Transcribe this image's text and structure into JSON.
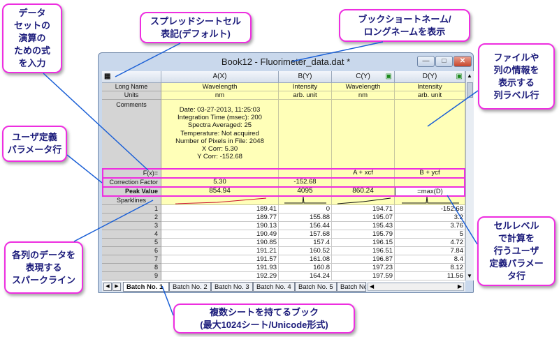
{
  "callouts": {
    "formula": "データ\nセットの\n演算の\nための式\nを入力",
    "spreadsheet_notation": "スプレッドシートセル\n表記(デフォルト)",
    "book_name": "ブックショートネーム/\nロングネームを表示",
    "label_rows": "ファイルや\n列の情報を\n表示する\n列ラベル行",
    "user_params": "ユーザ定義\nパラメータ行",
    "sparklines": "各列のデータを\n表現する\nスパークライン",
    "cell_calc": "セルレベル\nで計算を\n行うユーザ\n定義パラメー\nタ行",
    "sheets": "複数シートを持てるブック\n(最大1024シート/Unicode形式)"
  },
  "window": {
    "title": "Book12 - Fluorimeter_data.dat *"
  },
  "columns": [
    {
      "header": "A(X)",
      "long_name": "Wavelength",
      "units": "nm",
      "fx": "",
      "correction": "5.30",
      "peak": "854.94"
    },
    {
      "header": "B(Y)",
      "long_name": "Intensity",
      "units": "arb. unit",
      "fx": "",
      "correction": "-152.68",
      "peak": "4095"
    },
    {
      "header": "C(Y)",
      "long_name": "Wavelength",
      "units": "nm",
      "fx": "A + xcf",
      "correction": "",
      "peak": "860.24"
    },
    {
      "header": "D(Y)",
      "long_name": "Intensity",
      "units": "arb. unit",
      "fx": "B + ycf",
      "correction": "",
      "peak": "=max(D)"
    }
  ],
  "row_labels": {
    "long_name": "Long Name",
    "units": "Units",
    "comments": "Comments",
    "fx": "F(x)=",
    "correction": "Correction Factor",
    "peak": "Peak Value",
    "sparklines": "Sparklines"
  },
  "comments_lines": [
    "Date: 03-27-2013, 11:25:03",
    "Integration Time (msec): 200",
    "Spectra Averaged: 25",
    "Temperature: Not acquired",
    "Number of Pixels in File: 2048",
    "X Corr: 5.30",
    "Y Corr: -152.68"
  ],
  "data_rows": [
    {
      "n": "1",
      "a": "189.41",
      "b": "0",
      "c": "194.71",
      "d": "-152.68"
    },
    {
      "n": "2",
      "a": "189.77",
      "b": "155.88",
      "c": "195.07",
      "d": "3.2"
    },
    {
      "n": "3",
      "a": "190.13",
      "b": "156.44",
      "c": "195.43",
      "d": "3.76"
    },
    {
      "n": "4",
      "a": "190.49",
      "b": "157.68",
      "c": "195.79",
      "d": "5"
    },
    {
      "n": "5",
      "a": "190.85",
      "b": "157.4",
      "c": "196.15",
      "d": "4.72"
    },
    {
      "n": "6",
      "a": "191.21",
      "b": "160.52",
      "c": "196.51",
      "d": "7.84"
    },
    {
      "n": "7",
      "a": "191.57",
      "b": "161.08",
      "c": "196.87",
      "d": "8.4"
    },
    {
      "n": "8",
      "a": "191.93",
      "b": "160.8",
      "c": "197.23",
      "d": "8.12"
    },
    {
      "n": "9",
      "a": "192.29",
      "b": "164.24",
      "c": "197.59",
      "d": "11.56"
    }
  ],
  "tabs": [
    "Batch No. 1",
    "Batch No. 2",
    "Batch No. 3",
    "Batch No. 4",
    "Batch No. 5",
    "Batch No"
  ],
  "colors": {
    "callout_border": "#ee2ee0",
    "label_fill": "#ffffb8",
    "callout_text": "#1a1a7a"
  }
}
